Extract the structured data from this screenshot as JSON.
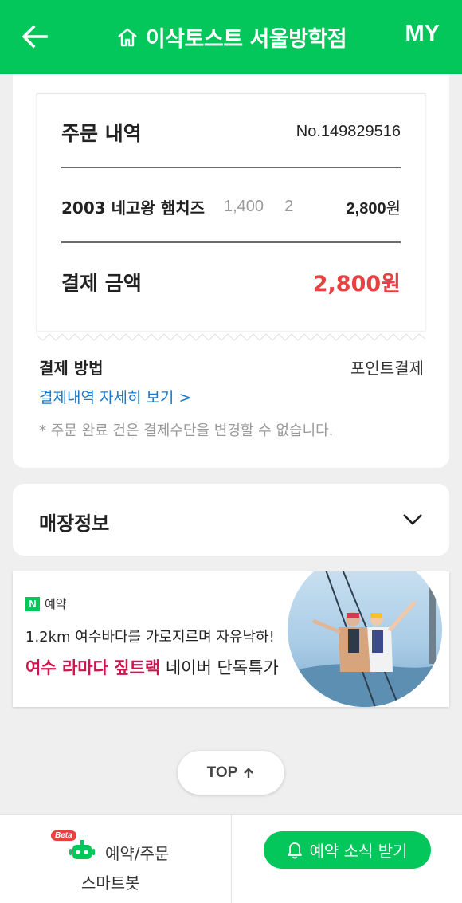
{
  "header": {
    "title": "이삭토스트 서울방학점",
    "my_label": "MY",
    "bg_color": "#03c75a"
  },
  "receipt": {
    "title": "주문 내역",
    "order_no": "No.149829516",
    "items": [
      {
        "name": "2003 네고왕 햄치즈",
        "unit_price": "1,400",
        "qty": "2",
        "amount": "2,800",
        "currency": "원"
      }
    ],
    "total_label": "결제 금액",
    "total_value": "2,800원",
    "total_color": "#e94141"
  },
  "payment": {
    "method_label": "결제 방법",
    "method_value": "포인트결제",
    "detail_link": "결제내역 자세히 보기 >",
    "note": "* 주문 완료 건은 결제수단을 변경할 수 없습니다."
  },
  "store": {
    "title": "매장정보"
  },
  "ad": {
    "badge": "예약",
    "line1": "1.2km 여수바다를 가로지르며 자유낙하!",
    "line2_highlight": "여수 라마다 짚트랙",
    "line2_rest": " 네이버 단독특가",
    "highlight_color": "#d0144e"
  },
  "top_button": {
    "label": "TOP"
  },
  "footer": {
    "beta": "Beta",
    "bot_line1": "예약/주문",
    "bot_line2": "스마트봇",
    "notify_label": "예약 소식 받기"
  }
}
